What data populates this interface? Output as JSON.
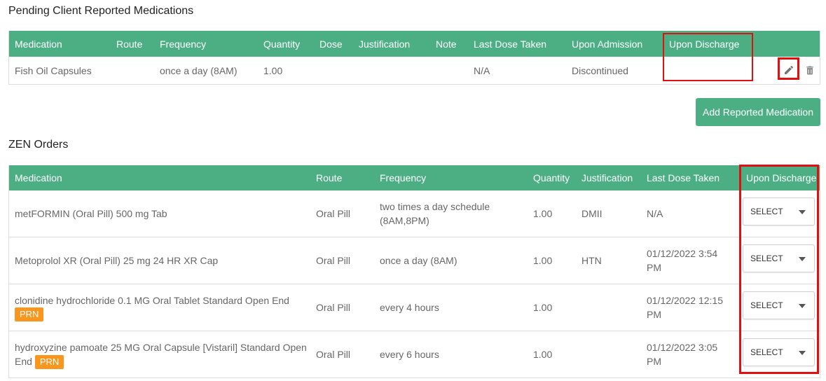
{
  "pending": {
    "title": "Pending Client Reported Medications",
    "headers": {
      "medication": "Medication",
      "route": "Route",
      "frequency": "Frequency",
      "quantity": "Quantity",
      "dose": "Dose",
      "justification": "Justification",
      "note": "Note",
      "last_dose": "Last Dose Taken",
      "upon_admission": "Upon Admission",
      "upon_discharge": "Upon Discharge"
    },
    "rows": [
      {
        "medication": "Fish Oil Capsules",
        "route": "",
        "frequency": "once a day (8AM)",
        "quantity": "1.00",
        "dose": "",
        "justification": "",
        "note": "",
        "last_dose": "N/A",
        "upon_admission": "Discontinued",
        "upon_discharge": ""
      }
    ],
    "add_button": "Add Reported Medication"
  },
  "zen": {
    "title": "ZEN Orders",
    "headers": {
      "medication": "Medication",
      "route": "Route",
      "frequency": "Frequency",
      "quantity": "Quantity",
      "justification": "Justification",
      "last_dose": "Last Dose Taken",
      "upon_discharge": "Upon Discharge"
    },
    "rows": [
      {
        "medication": "metFORMIN (Oral Pill) 500 mg Tab",
        "prn": "",
        "route": "Oral Pill",
        "frequency": "two times a day schedule (8AM,8PM)",
        "quantity": "1.00",
        "justification": "DMII",
        "last_dose": "N/A",
        "select": "SELECT"
      },
      {
        "medication": "Metoprolol XR (Oral Pill) 25 mg 24 HR XR Cap",
        "prn": "",
        "route": "Oral Pill",
        "frequency": "once a day (8AM)",
        "quantity": "1.00",
        "justification": "HTN",
        "last_dose": "01/12/2022 3:54 PM",
        "select": "SELECT"
      },
      {
        "medication": "clonidine hydrochloride 0.1 MG Oral Tablet Standard Open End",
        "prn": "PRN",
        "route": "Oral Pill",
        "frequency": "every 4 hours",
        "quantity": "1.00",
        "justification": "",
        "last_dose": "01/12/2022 12:15 PM",
        "select": "SELECT"
      },
      {
        "medication": "hydroxyzine pamoate 25 MG Oral Capsule [Vistaril] Standard Open End",
        "prn": "PRN",
        "route": "Oral Pill",
        "frequency": "every 6 hours",
        "quantity": "1.00",
        "justification": "",
        "last_dose": "01/12/2022 3:05 PM",
        "select": "SELECT"
      }
    ]
  },
  "icons": {
    "edit": "pencil-icon",
    "delete": "trash-icon",
    "dropdown": "caret-down-icon"
  },
  "colors": {
    "header_green": "#4caf84",
    "prn_orange": "#f8961e",
    "highlight_red": "#e01010"
  }
}
